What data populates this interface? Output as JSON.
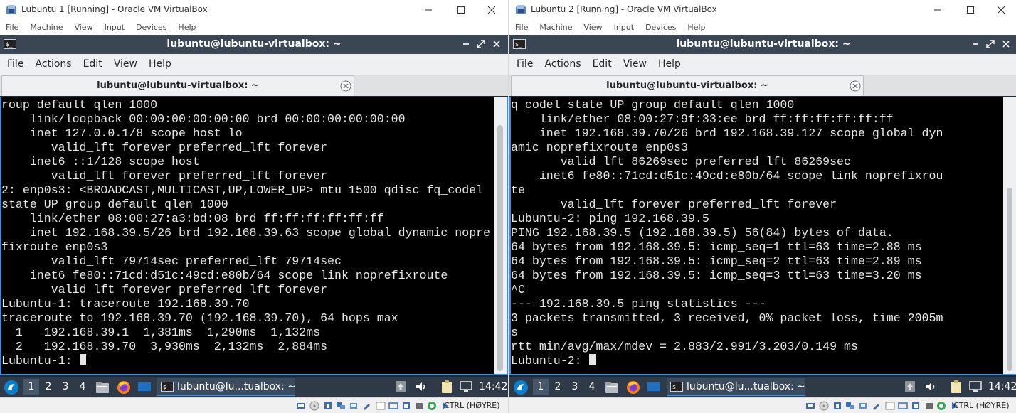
{
  "windows": [
    {
      "vbox_title": "Lubuntu 1 [Running] - Oracle VM VirtualBox",
      "vbox_menu": [
        "File",
        "Machine",
        "View",
        "Input",
        "Devices",
        "Help"
      ],
      "terminal_title": "lubuntu@lubuntu-virtualbox: ~",
      "terminal_menu": [
        "File",
        "Actions",
        "Edit",
        "View",
        "Help"
      ],
      "tab_label": "lubuntu@lubuntu-virtualbox: ~",
      "terminal_lines": [
        "roup default qlen 1000",
        "    link/loopback 00:00:00:00:00:00 brd 00:00:00:00:00:00",
        "    inet 127.0.0.1/8 scope host lo",
        "       valid_lft forever preferred_lft forever",
        "    inet6 ::1/128 scope host",
        "       valid_lft forever preferred_lft forever",
        "2: enp0s3: <BROADCAST,MULTICAST,UP,LOWER_UP> mtu 1500 qdisc fq_codel",
        "state UP group default qlen 1000",
        "    link/ether 08:00:27:a3:bd:08 brd ff:ff:ff:ff:ff:ff",
        "    inet 192.168.39.5/26 brd 192.168.39.63 scope global dynamic nopre",
        "fixroute enp0s3",
        "       valid_lft 79714sec preferred_lft 79714sec",
        "    inet6 fe80::71cd:d51c:49cd:e80b/64 scope link noprefixroute",
        "       valid_lft forever preferred_lft forever",
        "Lubuntu-1: traceroute 192.168.39.70",
        "traceroute to 192.168.39.70 (192.168.39.70), 64 hops max",
        "  1   192.168.39.1  1,381ms  1,290ms  1,132ms",
        "  2   192.168.39.70  3,930ms  2,132ms  2,884ms"
      ],
      "prompt": "Lubuntu-1: ",
      "workspaces": [
        "1",
        "2",
        "3",
        "4"
      ],
      "task_label": "lubuntu@lu...tualbox: ~",
      "clock": "14:42",
      "host_key": "CTRL (HØYRE)"
    },
    {
      "vbox_title": "Lubuntu 2 [Running] - Oracle VM VirtualBox",
      "vbox_menu": [
        "File",
        "Machine",
        "View",
        "Input",
        "Devices",
        "Help"
      ],
      "terminal_title": "lubuntu@lubuntu-virtualbox: ~",
      "terminal_menu": [
        "File",
        "Actions",
        "Edit",
        "View",
        "Help"
      ],
      "tab_label": "lubuntu@lubuntu-virtualbox: ~",
      "terminal_lines": [
        "q_codel state UP group default qlen 1000",
        "    link/ether 08:00:27:9f:33:ee brd ff:ff:ff:ff:ff:ff",
        "    inet 192.168.39.70/26 brd 192.168.39.127 scope global dyn",
        "amic noprefixroute enp0s3",
        "       valid_lft 86269sec preferred_lft 86269sec",
        "    inet6 fe80::71cd:d51c:49cd:e80b/64 scope link noprefixrou",
        "te",
        "       valid_lft forever preferred_lft forever",
        "Lubuntu-2: ping 192.168.39.5",
        "PING 192.168.39.5 (192.168.39.5) 56(84) bytes of data.",
        "64 bytes from 192.168.39.5: icmp_seq=1 ttl=63 time=2.88 ms",
        "64 bytes from 192.168.39.5: icmp_seq=2 ttl=63 time=2.89 ms",
        "64 bytes from 192.168.39.5: icmp_seq=3 ttl=63 time=3.20 ms",
        "^C",
        "--- 192.168.39.5 ping statistics ---",
        "3 packets transmitted, 3 received, 0% packet loss, time 2005m",
        "s",
        "rtt min/avg/max/mdev = 2.883/2.991/3.203/0.149 ms"
      ],
      "prompt": "Lubuntu-2: ",
      "workspaces": [
        "1",
        "2",
        "3",
        "4"
      ],
      "task_label": "lubuntu@lu...tualbox: ~",
      "clock": "14:42",
      "host_key": "CTRL (HØYRE)"
    }
  ],
  "icons": {
    "vbox_app": "virtualbox-icon",
    "terminal": "terminal-icon",
    "start_menu": "lubuntu-start-icon",
    "quicklaunch": [
      "file-manager-icon",
      "firefox-icon",
      "desktop-icon"
    ],
    "tray": [
      "update-icon",
      "volume-icon",
      "clipboard-icon",
      "display-icon"
    ]
  },
  "colors": {
    "terminal_bg": "#000000",
    "terminal_fg": "#e6e6e6",
    "accent": "#3d8fd8",
    "titlebar": "#3b4654",
    "panel": "#2e3a48"
  }
}
